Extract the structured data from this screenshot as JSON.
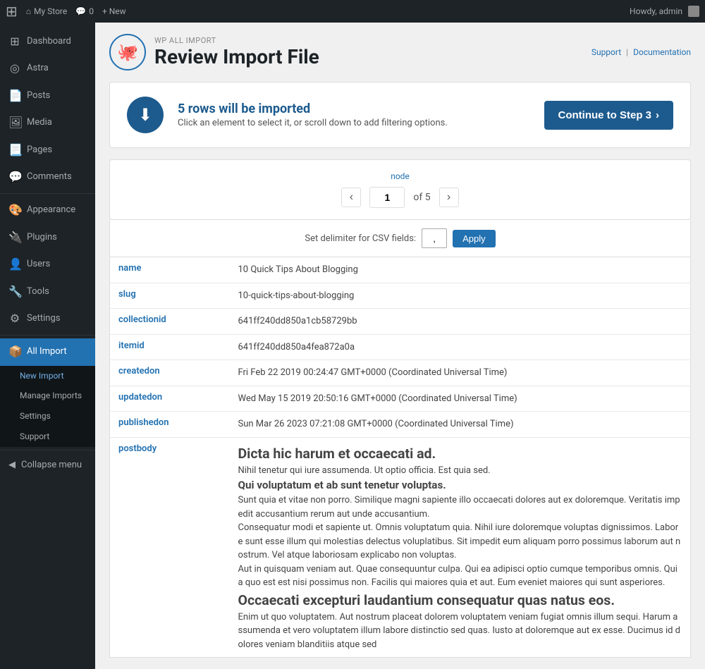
{
  "adminbar": {
    "wp_logo": "⊞",
    "site_name": "My Store",
    "comments_icon": "💬",
    "comments_count": "0",
    "new_label": "+ New",
    "howdy": "Howdy, admin"
  },
  "sidebar": {
    "items": [
      {
        "id": "dashboard",
        "icon": "⊞",
        "label": "Dashboard"
      },
      {
        "id": "astra",
        "icon": "◎",
        "label": "Astra"
      },
      {
        "id": "posts",
        "icon": "📄",
        "label": "Posts"
      },
      {
        "id": "media",
        "icon": "🖼",
        "label": "Media"
      },
      {
        "id": "pages",
        "icon": "📃",
        "label": "Pages"
      },
      {
        "id": "comments",
        "icon": "💬",
        "label": "Comments"
      },
      {
        "id": "appearance",
        "icon": "🎨",
        "label": "Appearance"
      },
      {
        "id": "plugins",
        "icon": "🔌",
        "label": "Plugins"
      },
      {
        "id": "users",
        "icon": "👤",
        "label": "Users"
      },
      {
        "id": "tools",
        "icon": "🔧",
        "label": "Tools"
      },
      {
        "id": "settings",
        "icon": "⚙",
        "label": "Settings"
      }
    ],
    "all_import": {
      "label": "All Import",
      "submenu": [
        {
          "id": "new-import",
          "label": "New Import"
        },
        {
          "id": "manage-imports",
          "label": "Manage Imports"
        },
        {
          "id": "settings",
          "label": "Settings"
        },
        {
          "id": "support",
          "label": "Support"
        }
      ]
    },
    "collapse_label": "Collapse menu"
  },
  "plugin": {
    "brand": "WP ALL IMPORT",
    "title": "Review Import File",
    "icon": "🐙",
    "support_label": "Support",
    "separator": "|",
    "documentation_label": "Documentation"
  },
  "banner": {
    "icon": "⬇",
    "headline": "5 rows will be imported",
    "subtext": "Click an element to select it, or scroll down to add filtering options.",
    "button_label": "Continue to Step 3",
    "button_arrow": "›"
  },
  "node": {
    "label": "node",
    "current": "1",
    "total": "5",
    "of_text": "of 5",
    "prev_arrow": "‹",
    "next_arrow": "›"
  },
  "delimiter": {
    "label": "Set delimiter for CSV fields:",
    "value": ",",
    "apply_label": "Apply"
  },
  "table": {
    "rows": [
      {
        "field": "name",
        "value": "10 Quick Tips About Blogging"
      },
      {
        "field": "slug",
        "value": "10-quick-tips-about-blogging"
      },
      {
        "field": "collectionid",
        "value": "641ff240dd850a1cb58729bb"
      },
      {
        "field": "itemid",
        "value": "641ff240dd850a4fea872a0a"
      },
      {
        "field": "createdon",
        "value": "Fri Feb 22 2019 00:24:47 GMT+0000 (Coordinated Universal Time)"
      },
      {
        "field": "updatedon",
        "value": "Wed May 15 2019 20:50:16 GMT+0000 (Coordinated Universal Time)"
      },
      {
        "field": "publishedon",
        "value": "Sun Mar 26 2023 07:21:08 GMT+0000 (Coordinated Universal Time)"
      },
      {
        "field": "postbody",
        "value": "<h2>Dicta hic harum et occaecati ad.</h2><p>Nihil tenetur qui iure assumenda. Ut optio officia. Est quia sed.</p><h3>Qui voluptatum et ab sunt tenetur voluptas.</h3><blockquote>Sunt quia et vitae non porro. Similique magni sapiente illo occaecati dolores aut ex doloremque. Veritatis impedit accusantium rerum aut unde accusantium.</blockquote><p>Consequatur modi et sapiente ut. Omnis voluptatum quia. Nihil iure doloremque voluptas dignissimos. Labore sunt esse illum qui molestias delectus voluplatibus. Sit impedit eum aliquam porro possimus laborum aut nostrum. Vel atque laboriosam explicabo non voluptas.</p><p>Aut in quisquam veniam aut. Quae consequuntur culpa. Qui ea adipisci optio cumque temporibus omnis. Quia quo est est nisi possimus non. Facilis qui maiores quia et aut. Eum eveniet maiores qui sunt asperiores.</p><h2>Occaecati excepturi laudantium consequatur quas natus eos.</h2><p>Enim ut quo voluptatem. Aut nostrum placeat dolorem voluptatem veniam fugiat omnis illum sequi. Harum assumenda et vero voluptatem illum labore distinctio sed quas. Iusto at doloremque aut ex esse. Ducimus id dolores veniam blanditiis atque sed"
      }
    ]
  }
}
